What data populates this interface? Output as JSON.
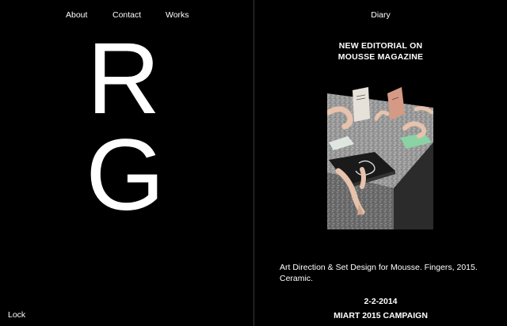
{
  "nav": {
    "about": "About",
    "contact": "Contact",
    "works": "Works"
  },
  "monogram": {
    "first": "R",
    "second": "G"
  },
  "footer": {
    "lock": "Lock"
  },
  "diary": {
    "label": "Diary",
    "headline_line1": "NEW EDITORIAL ON",
    "headline_line2": "MOUSSE MAGAZINE",
    "caption": "Art Direction & Set Design for Mousse. Fingers, 2015. Ceramic.",
    "date": "2-2-2014",
    "next_title": "MIART 2015 CAMPAIGN"
  },
  "colors": {
    "background": "#000000",
    "text": "#ffffff",
    "divider": "#3a3a3a"
  }
}
